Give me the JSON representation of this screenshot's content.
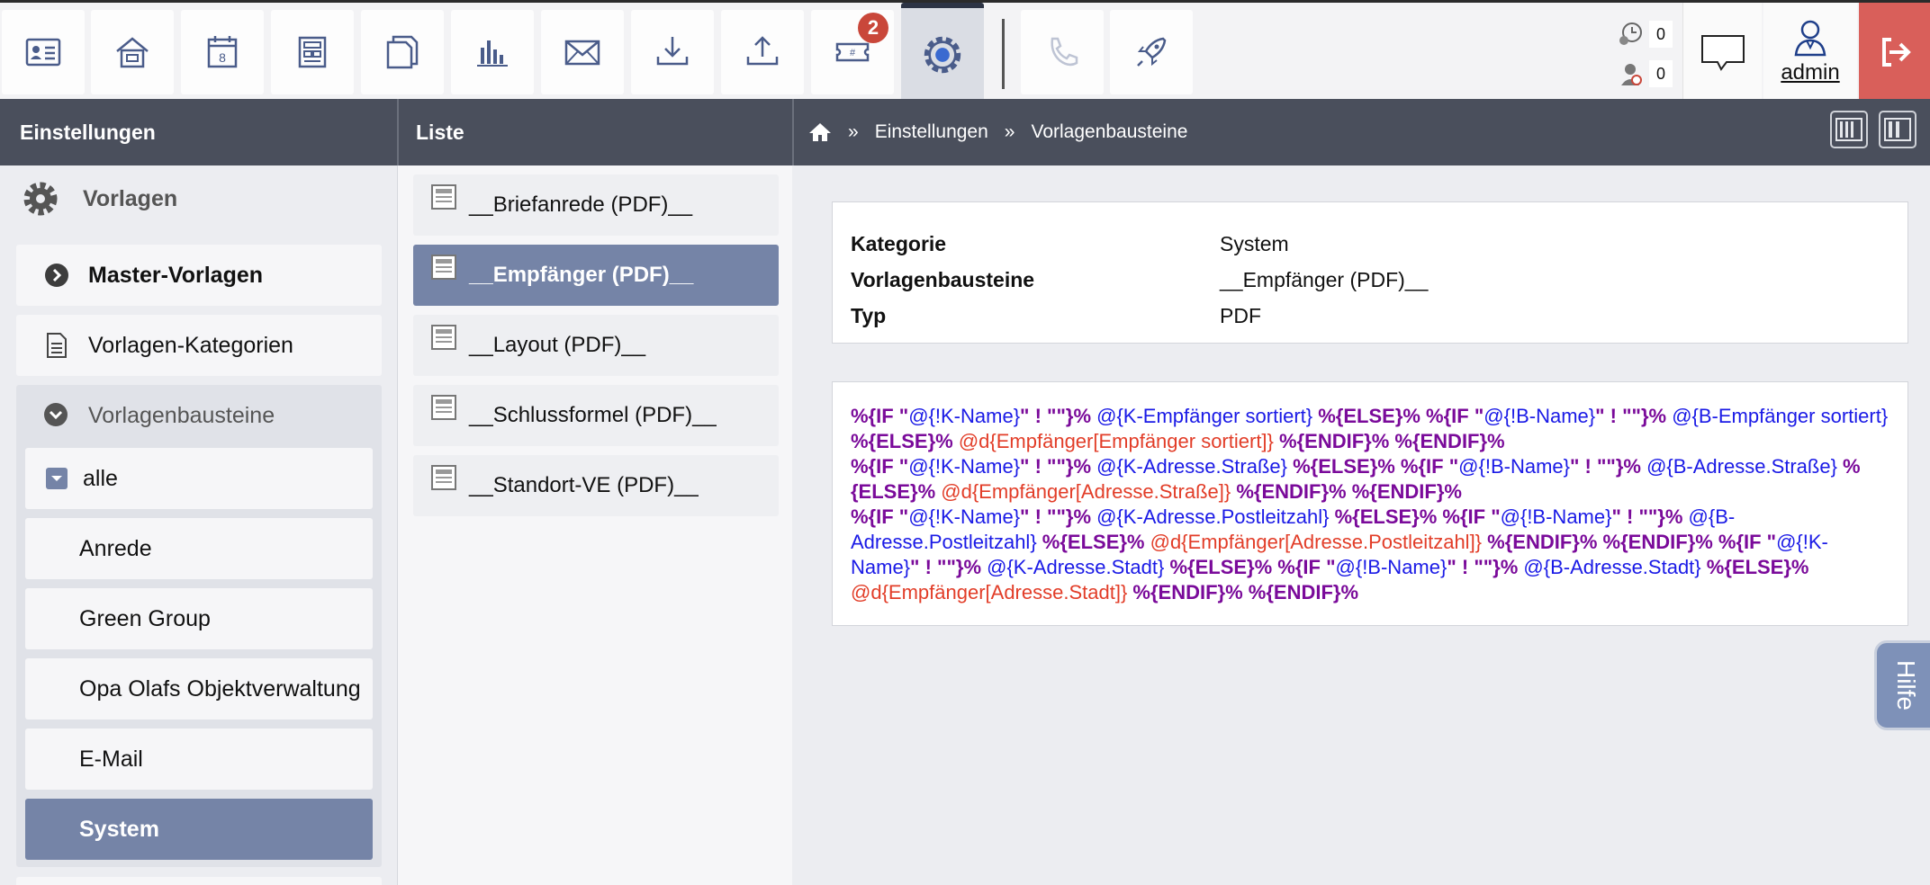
{
  "toolbar": {
    "badge_count": "2",
    "buttons": [
      {
        "name": "contacts-card-icon"
      },
      {
        "name": "home-icon"
      },
      {
        "name": "calendar-icon",
        "day": "8"
      },
      {
        "name": "layout-icon"
      },
      {
        "name": "documents-icon"
      },
      {
        "name": "statistics-icon"
      },
      {
        "name": "mail-icon"
      },
      {
        "name": "download-icon"
      },
      {
        "name": "upload-icon"
      },
      {
        "name": "ticket-icon"
      },
      {
        "name": "settings-gear-icon"
      },
      {
        "name": "phone-icon"
      },
      {
        "name": "rocket-icon"
      }
    ]
  },
  "counters": {
    "clock_count": "0",
    "user_count": "0"
  },
  "user": {
    "name": "admin"
  },
  "header": {
    "left_title": "Einstellungen",
    "middle_title": "Liste",
    "breadcrumb": {
      "sep": "»",
      "items": [
        "Einstellungen",
        "Vorlagenbausteine"
      ]
    }
  },
  "sidebar": {
    "section_title": "Vorlagen",
    "items": [
      {
        "label": "Master-Vorlagen"
      },
      {
        "label": "Vorlagen-Kategorien"
      },
      {
        "label": "Vorlagenbausteine"
      }
    ],
    "sub_items": [
      {
        "label": "alle"
      },
      {
        "label": "Anrede"
      },
      {
        "label": "Green Group"
      },
      {
        "label": "Opa Olafs Objektverwaltung"
      },
      {
        "label": "E-Mail"
      },
      {
        "label": "System"
      }
    ]
  },
  "list": {
    "items": [
      {
        "label": "__Briefanrede (PDF)__"
      },
      {
        "label": "__Empfänger (PDF)__"
      },
      {
        "label": "__Layout (PDF)__"
      },
      {
        "label": "__Schlussformel (PDF)__"
      },
      {
        "label": "__Standort-VE (PDF)__"
      }
    ]
  },
  "detail": {
    "rows": [
      {
        "key": "Kategorie",
        "value": "System"
      },
      {
        "key": "Vorlagenbausteine",
        "value": "__Empfänger (PDF)__"
      },
      {
        "key": "Typ",
        "value": "PDF"
      }
    ],
    "code_segments": [
      {
        "t": "%{IF \"",
        "c": "p"
      },
      {
        "t": "@{!K-Name}",
        "c": "b"
      },
      {
        "t": "\" ! \"\"}%",
        "c": "p"
      },
      {
        "t": " @{K-Empfänger sortiert} ",
        "c": "b"
      },
      {
        "t": "%{ELSE}% %{IF \"",
        "c": "p"
      },
      {
        "t": "@{!B-Name}",
        "c": "b"
      },
      {
        "t": "\" ! \"\"}%",
        "c": "p"
      },
      {
        "t": " @{B-Empfänger sortiert} ",
        "c": "b"
      },
      {
        "t": "%{ELSE}% ",
        "c": "p"
      },
      {
        "t": "@d{Empfänger[Empfänger sortiert]}",
        "c": "r"
      },
      {
        "t": " %{ENDIF}% %{ENDIF}%",
        "c": "p"
      },
      {
        "br": true
      },
      {
        "t": "%{IF \"",
        "c": "p"
      },
      {
        "t": "@{!K-Name}",
        "c": "b"
      },
      {
        "t": "\" ! \"\"}%",
        "c": "p"
      },
      {
        "t": " @{K-Adresse.Straße} ",
        "c": "b"
      },
      {
        "t": "%{ELSE}% %{IF \"",
        "c": "p"
      },
      {
        "t": "@{!B-Name}",
        "c": "b"
      },
      {
        "t": "\" ! \"\"}%",
        "c": "p"
      },
      {
        "t": " @{B-Adresse.Straße} ",
        "c": "b"
      },
      {
        "t": "%{ELSE}% ",
        "c": "p"
      },
      {
        "t": "@d{Empfänger[Adresse.Straße]}",
        "c": "r"
      },
      {
        "t": " %{ENDIF}% %{ENDIF}%",
        "c": "p"
      },
      {
        "br": true
      },
      {
        "t": "%{IF \"",
        "c": "p"
      },
      {
        "t": "@{!K-Name}",
        "c": "b"
      },
      {
        "t": "\" ! \"\"}%",
        "c": "p"
      },
      {
        "t": " @{K-Adresse.Postleitzahl} ",
        "c": "b"
      },
      {
        "t": "%{ELSE}% %{IF \"",
        "c": "p"
      },
      {
        "t": "@{!B-Name}",
        "c": "b"
      },
      {
        "t": "\" ! \"\"}%",
        "c": "p"
      },
      {
        "t": " @{B-Adresse.Postleitzahl} ",
        "c": "b"
      },
      {
        "t": "%{ELSE}% ",
        "c": "p"
      },
      {
        "t": "@d{Empfänger[Adresse.Postleitzahl]}",
        "c": "r"
      },
      {
        "t": " %{ENDIF}% %{ENDIF}% %{IF \"",
        "c": "p"
      },
      {
        "t": "@{!K-Name}",
        "c": "b"
      },
      {
        "t": "\" ! \"\"}%",
        "c": "p"
      },
      {
        "t": " @{K-Adresse.Stadt} ",
        "c": "b"
      },
      {
        "t": "%{ELSE}% %{IF \"",
        "c": "p"
      },
      {
        "t": "@{!B-Name}",
        "c": "b"
      },
      {
        "t": "\" ! \"\"}%",
        "c": "p"
      },
      {
        "t": " @{B-Adresse.Stadt} ",
        "c": "b"
      },
      {
        "t": "%{ELSE}% ",
        "c": "p"
      },
      {
        "t": "@d{Empfänger[Adresse.Stadt]}",
        "c": "r"
      },
      {
        "t": " %{ENDIF}% %{ENDIF}%",
        "c": "p"
      }
    ]
  },
  "help": {
    "label": "Hilfe"
  },
  "colors": {
    "header_bg": "#4a4f5c",
    "active_item": "#7584a7",
    "logout": "#d95f5a",
    "badge": "#c9473a",
    "code_keyword": "#7a0a9a",
    "code_field": "#1a1ae6",
    "code_data": "#e23d28"
  }
}
